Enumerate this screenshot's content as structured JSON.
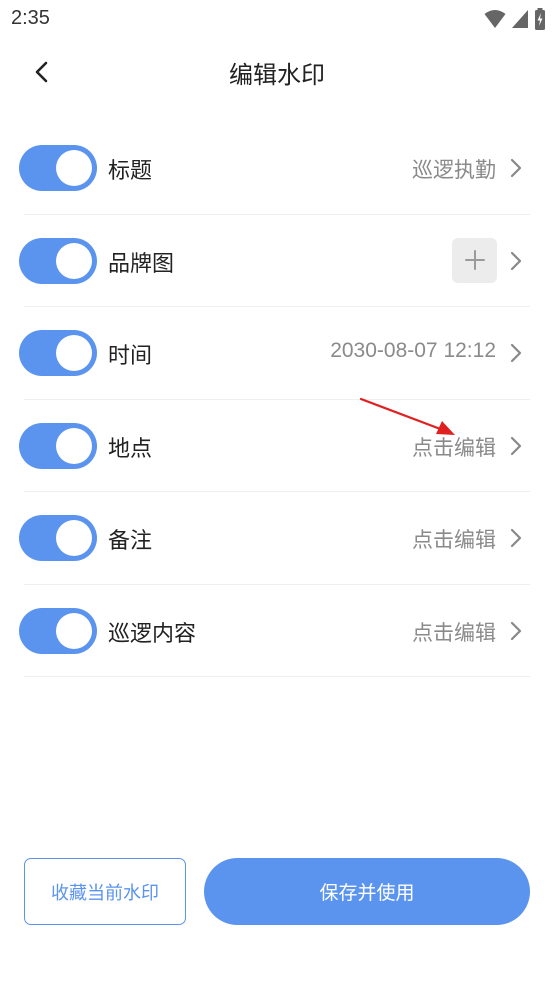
{
  "status_bar": {
    "time": "2:35"
  },
  "header": {
    "title": "编辑水印"
  },
  "rows": [
    {
      "label": "标题",
      "value": "巡逻执勤",
      "enabled": true
    },
    {
      "label": "品牌图",
      "value": "",
      "enabled": true
    },
    {
      "label": "时间",
      "value": "2030-08-07 12:12",
      "enabled": true
    },
    {
      "label": "地点",
      "value": "点击编辑",
      "enabled": true
    },
    {
      "label": "备注",
      "value": "点击编辑",
      "enabled": true
    },
    {
      "label": "巡逻内容",
      "value": "点击编辑",
      "enabled": true
    }
  ],
  "footer": {
    "favorite_label": "收藏当前水印",
    "save_label": "保存并使用"
  },
  "colors": {
    "accent": "#5b94ee",
    "annotation": "#e02020"
  }
}
